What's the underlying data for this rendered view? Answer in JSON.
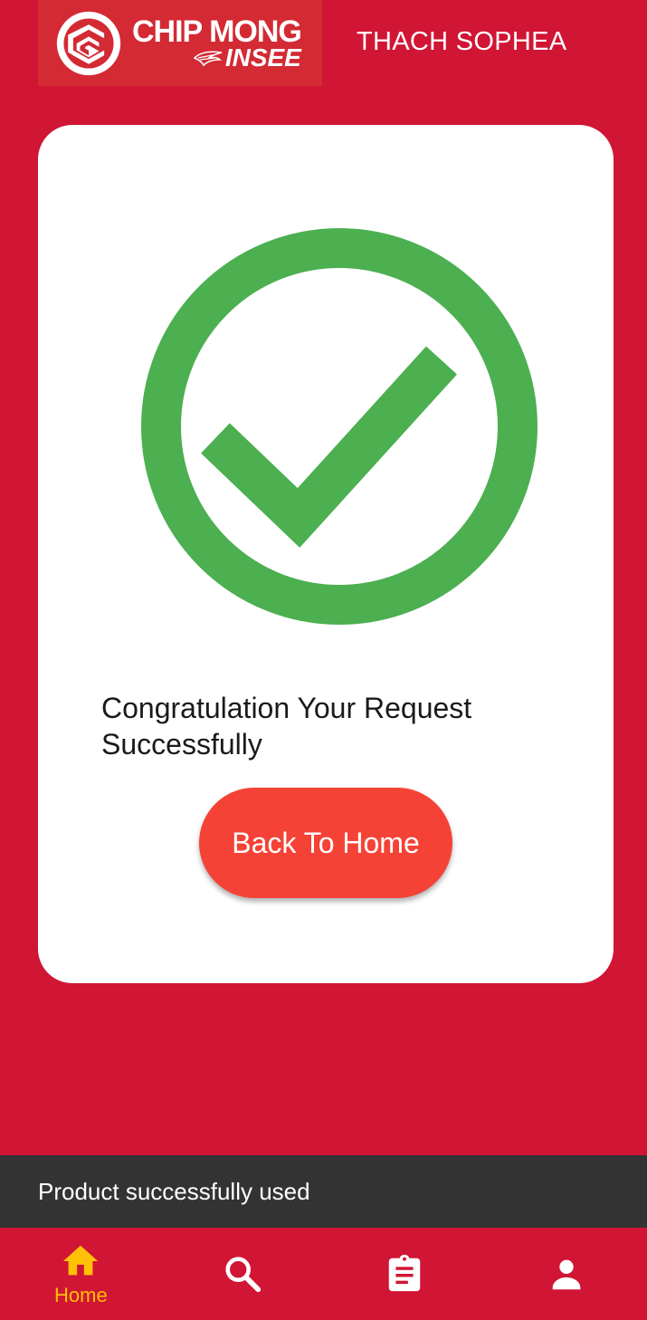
{
  "header": {
    "logo": {
      "line1": "CHIP MONG",
      "line2": "INSEE"
    },
    "username": "THACH SOPHEA"
  },
  "card": {
    "icon": "check-circle-icon",
    "message": "Congratulation Your Request Successfully",
    "button_label": "Back To Home"
  },
  "snackbar": {
    "text": "Product successfully used"
  },
  "bottom_nav": {
    "items": [
      {
        "icon": "home-icon",
        "label": "Home",
        "active": true
      },
      {
        "icon": "search-icon",
        "label": "",
        "active": false
      },
      {
        "icon": "clipboard-icon",
        "label": "",
        "active": false
      },
      {
        "icon": "person-icon",
        "label": "",
        "active": false
      }
    ]
  },
  "colors": {
    "background": "#d11534",
    "logo_box": "#d32a34",
    "success_green": "#4caf50",
    "button": "#f44336",
    "snackbar": "#333333",
    "nav_active": "#ffc107",
    "nav_inactive": "#ffffff"
  }
}
